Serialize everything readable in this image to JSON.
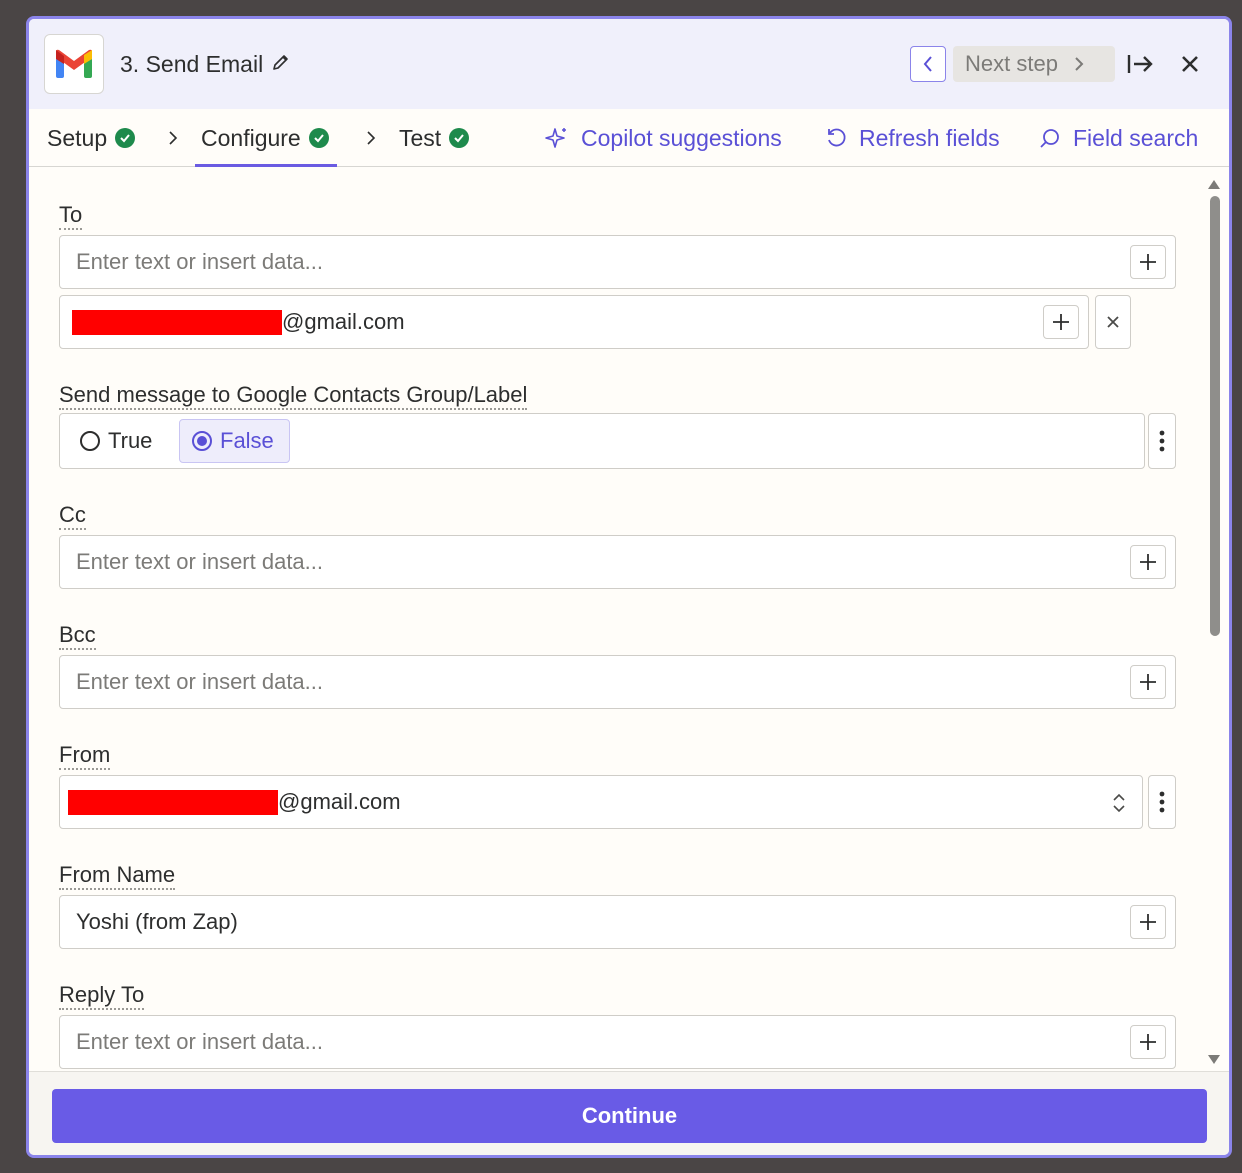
{
  "colors": {
    "accent": "#695be6",
    "success": "#1e8a4c",
    "redacted": "#ff0000"
  },
  "header": {
    "step_title": "3. Send Email",
    "next_step_label": "Next step",
    "icons": [
      "gmail-logo",
      "pencil-icon",
      "chevron-left-icon",
      "chevron-right-icon",
      "dock-right-icon",
      "close-icon"
    ]
  },
  "tabs": [
    {
      "label": "Setup",
      "status": "complete"
    },
    {
      "label": "Configure",
      "status": "complete",
      "active": true
    },
    {
      "label": "Test",
      "status": "complete"
    }
  ],
  "actions": {
    "copilot": "Copilot suggestions",
    "refresh": "Refresh fields",
    "field_search": "Field search"
  },
  "fields": {
    "to": {
      "label": "To",
      "placeholder": "Enter text or insert data...",
      "value_suffix": "@gmail.com"
    },
    "contacts_group": {
      "label": "Send message to Google Contacts Group/Label",
      "option_true": "True",
      "option_false": "False",
      "selected": "False"
    },
    "cc": {
      "label": "Cc",
      "placeholder": "Enter text or insert data..."
    },
    "bcc": {
      "label": "Bcc",
      "placeholder": "Enter text or insert data..."
    },
    "from": {
      "label": "From",
      "value_suffix": "@gmail.com"
    },
    "from_name": {
      "label": "From Name",
      "value": "Yoshi (from Zap)"
    },
    "reply_to": {
      "label": "Reply To",
      "placeholder": "Enter text or insert data..."
    }
  },
  "footer": {
    "continue_label": "Continue"
  }
}
